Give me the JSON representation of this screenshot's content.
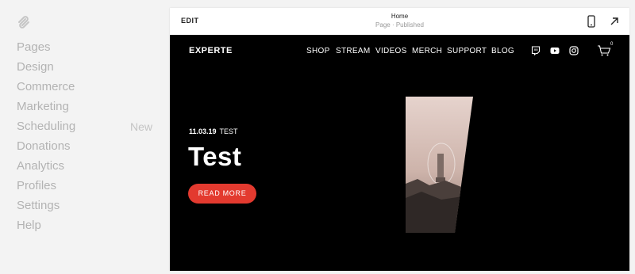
{
  "sidebar": {
    "items": [
      {
        "label": "Pages",
        "badge": ""
      },
      {
        "label": "Design",
        "badge": ""
      },
      {
        "label": "Commerce",
        "badge": ""
      },
      {
        "label": "Marketing",
        "badge": ""
      },
      {
        "label": "Scheduling",
        "badge": "New"
      },
      {
        "label": "Donations",
        "badge": ""
      },
      {
        "label": "Analytics",
        "badge": ""
      },
      {
        "label": "Profiles",
        "badge": ""
      },
      {
        "label": "Settings",
        "badge": ""
      },
      {
        "label": "Help",
        "badge": ""
      }
    ],
    "logo_icon": "squarespace-logo-icon"
  },
  "topbar": {
    "edit_label": "EDIT",
    "page_title": "Home",
    "page_status": "Page · Published",
    "mobile_icon": "mobile-preview-icon",
    "open_icon": "open-external-arrow-icon"
  },
  "site": {
    "brand": "EXPERTE",
    "menu": [
      "SHOP",
      "STREAM",
      "VIDEOS",
      "MERCH",
      "SUPPORT",
      "BLOG"
    ],
    "social_icons": [
      "twitch-icon",
      "youtube-icon",
      "instagram-icon"
    ],
    "cart_count": "0",
    "post": {
      "date": "11.03.19",
      "category": "TEST",
      "title": "Test",
      "button": "READ MORE"
    }
  },
  "colors": {
    "sidebar_bg": "#f3f3f3",
    "sidebar_text": "#b3b3b3",
    "site_bg": "#000000",
    "accent": "#e33a2f"
  }
}
